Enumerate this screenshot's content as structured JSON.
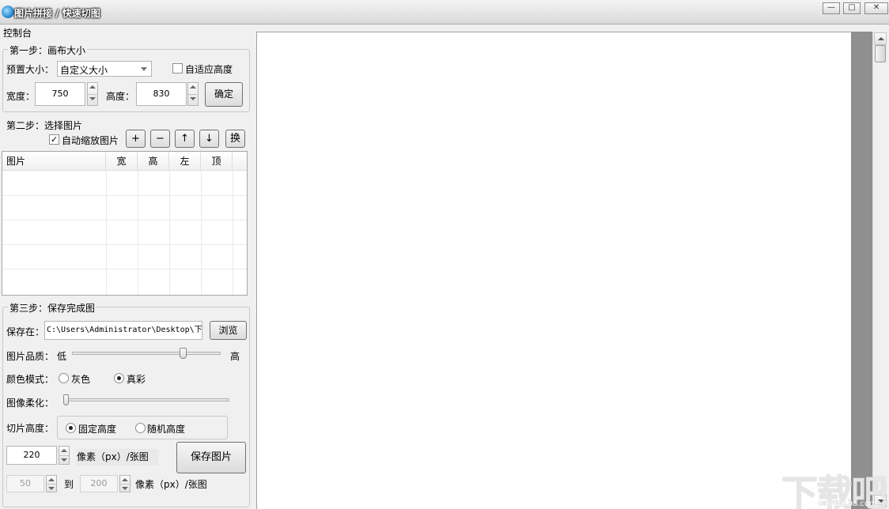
{
  "window": {
    "title": "图片拼接 / 快速切图",
    "minimize": "—",
    "maximize": "□",
    "close": "✕"
  },
  "console_label": "控制台",
  "step1": {
    "legend": "第一步：画布大小",
    "preset_label": "预置大小：",
    "preset_value": "自定义大小",
    "auto_height_label": "自适应高度",
    "auto_height_checked": false,
    "width_label": "宽度：",
    "width_value": "750",
    "height_label": "高度：",
    "height_value": "830",
    "confirm_button": "确定"
  },
  "step2": {
    "legend": "第二步：选择图片",
    "auto_zoom_label": "自动缩放图片",
    "auto_zoom_checked": true,
    "add_button": "+",
    "remove_button": "−",
    "up_button": "↑",
    "down_button": "↓",
    "swap_button": "换",
    "columns": [
      "图片",
      "宽",
      "高",
      "左",
      "顶"
    ],
    "rows": []
  },
  "step3": {
    "legend": "第三步：保存完成图",
    "save_to_label": "保存在：",
    "save_path": "C:\\Users\\Administrator\\Desktop\\下",
    "browse_button": "浏览",
    "quality_label": "图片品质：",
    "quality_low": "低",
    "quality_high": "高",
    "quality_level": 0.75,
    "color_mode_label": "颜色模式：",
    "color_gray": "灰色",
    "color_true": "真彩",
    "color_selected": "真彩",
    "soften_label": "图像柔化：",
    "soften_level": 0,
    "slice_height_label": "切片高度：",
    "fixed_height": "固定高度",
    "random_height": "随机高度",
    "slice_selected": "固定高度",
    "fixed_value": "220",
    "unit_label": "像素（px）/张图",
    "save_button": "保存图片",
    "random_min": "50",
    "to_label": "到",
    "random_max": "200",
    "random_unit_label": "像素（px）/张图"
  },
  "watermark": {
    "text": "下载吧",
    "sub": "www.xiazaiba.com"
  }
}
